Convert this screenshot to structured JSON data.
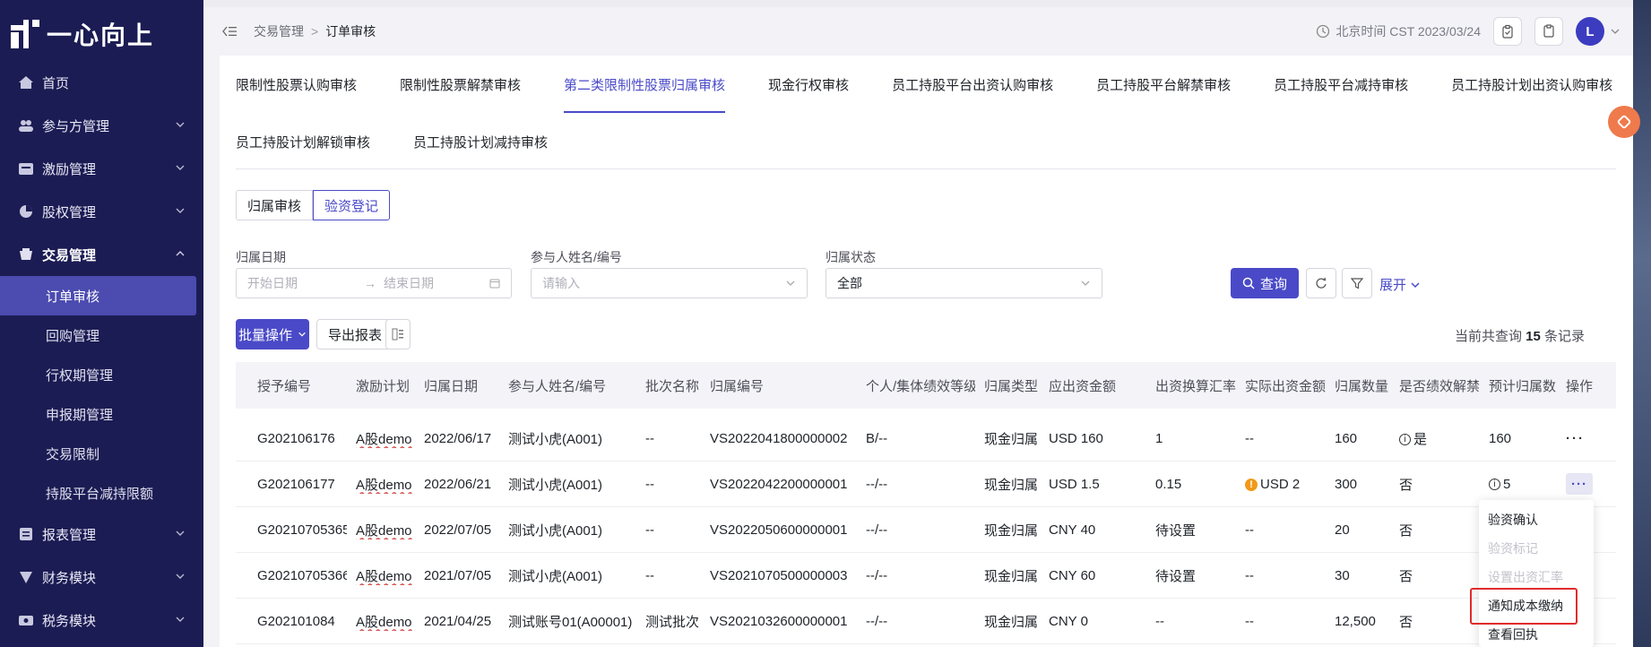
{
  "app": {
    "logo_text": "一心向上"
  },
  "sidebar": {
    "items": [
      {
        "label": "首页",
        "icon": "home-icon"
      },
      {
        "label": "参与方管理",
        "icon": "people-icon"
      },
      {
        "label": "激励管理",
        "icon": "incentive-icon"
      },
      {
        "label": "股权管理",
        "icon": "equity-icon"
      },
      {
        "label": "交易管理",
        "icon": "trade-icon"
      }
    ],
    "sub_items": [
      "订单审核",
      "回购管理",
      "行权期管理",
      "申报期管理",
      "交易限制",
      "持股平台减持限额"
    ],
    "bottom_items": [
      {
        "label": "报表管理",
        "icon": "report-icon"
      },
      {
        "label": "财务模块",
        "icon": "finance-icon"
      },
      {
        "label": "税务模块",
        "icon": "tax-icon"
      }
    ]
  },
  "header": {
    "breadcrumb_parent": "交易管理",
    "breadcrumb_sep": ">",
    "breadcrumb_current": "订单审核",
    "time_text": "北京时间 CST 2023/03/24",
    "avatar_letter": "L"
  },
  "tabs": {
    "row1": [
      "限制性股票认购审核",
      "限制性股票解禁审核",
      "第二类限制性股票归属审核",
      "现金行权审核",
      "员工持股平台出资认购审核",
      "员工持股平台解禁审核",
      "员工持股平台减持审核",
      "员工持股计划出资认购审核"
    ],
    "row2": [
      "员工持股计划解锁审核",
      "员工持股计划减持审核"
    ],
    "active": "第二类限制性股票归属审核"
  },
  "segment": {
    "left": "归属审核",
    "right": "验资登记"
  },
  "filters": {
    "date_label": "归属日期",
    "start_placeholder": "开始日期",
    "end_placeholder": "结束日期",
    "arrow": "→",
    "participant_label": "参与人姓名/编号",
    "participant_placeholder": "请输入",
    "status_label": "归属状态",
    "status_value": "全部"
  },
  "actions": {
    "query": "查询",
    "expand": "展开",
    "batch": "批量操作",
    "export": "导出报表",
    "record_prefix": "当前共查询",
    "record_count": "15",
    "record_suffix": "条记录"
  },
  "table": {
    "headers": [
      "授予编号",
      "激励计划",
      "归属日期",
      "参与人姓名/编号",
      "批次名称",
      "归属编号",
      "个人/集体绩效等级",
      "归属类型",
      "应出资金额",
      "出资换算汇率",
      "实际出资金额",
      "归属数量",
      "是否绩效解禁",
      "预计归属数",
      "操作"
    ],
    "rows": [
      [
        "G202106176",
        "A股demo",
        "2022/06/17",
        "测试小虎(A001)",
        "--",
        "VS2022041800000002",
        "B/--",
        "现金归属",
        "USD 160",
        "1",
        "--",
        "160",
        "是",
        "160",
        "···"
      ],
      [
        "G202106177",
        "A股demo",
        "2022/06/21",
        "测试小虎(A001)",
        "--",
        "VS2022042200000001",
        "--/--",
        "现金归属",
        "USD 1.5",
        "0.15",
        "USD 2",
        "300",
        "否",
        "5",
        "···"
      ],
      [
        "G20210705365",
        "A股demo",
        "2022/07/05",
        "测试小虎(A001)",
        "--",
        "VS2022050600000001",
        "--/--",
        "现金归属",
        "CNY 40",
        "待设置",
        "--",
        "20",
        "否",
        "",
        ""
      ],
      [
        "G20210705366",
        "A股demo",
        "2021/07/05",
        "测试小虎(A001)",
        "--",
        "VS2021070500000003",
        "--/--",
        "现金归属",
        "CNY 60",
        "待设置",
        "--",
        "30",
        "否",
        "",
        ""
      ],
      [
        "G202101084",
        "A股demo",
        "2021/04/25",
        "测试账号01(A00001)",
        "测试批次",
        "VS2021032600000001",
        "--/--",
        "现金归属",
        "CNY 0",
        "--",
        "--",
        "12,500",
        "否",
        "",
        ""
      ]
    ]
  },
  "dropdown": {
    "items": [
      {
        "label": "验资确认",
        "disabled": false
      },
      {
        "label": "验资标记",
        "disabled": true
      },
      {
        "label": "设置出资汇率",
        "disabled": true
      },
      {
        "label": "通知成本缴纳",
        "disabled": false
      },
      {
        "label": "查看回执",
        "disabled": false
      }
    ]
  },
  "colors": {
    "sidebar_bg": "#1c1c54",
    "accent": "#4a4ac8",
    "highlight": "#e02b2b",
    "warn": "#f09a18"
  }
}
